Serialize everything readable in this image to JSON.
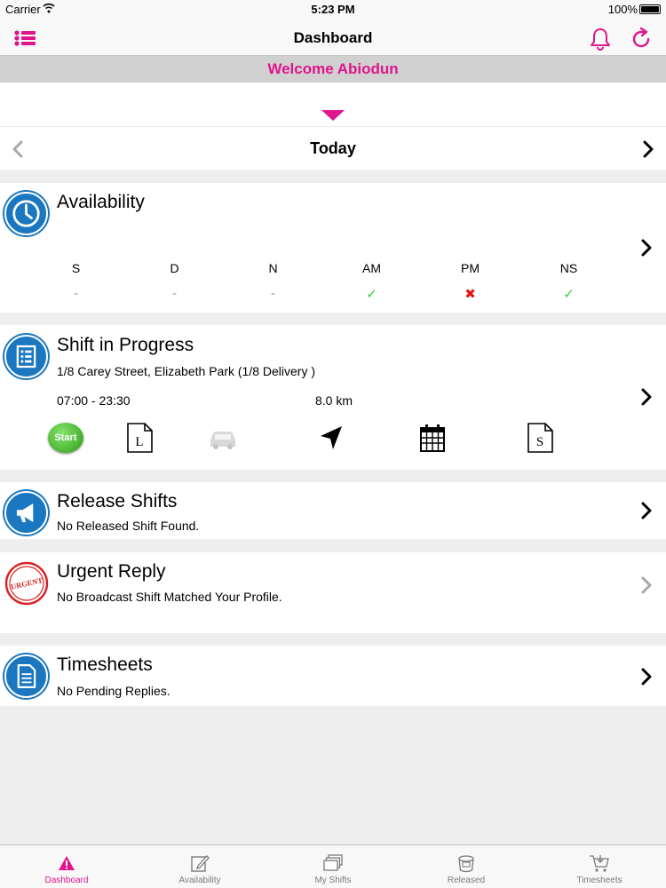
{
  "status": {
    "carrier": "Carrier",
    "time": "5:23 PM",
    "battery": "100%"
  },
  "nav": {
    "title": "Dashboard",
    "welcome": "Welcome Abiodun"
  },
  "date_nav": {
    "label": "Today"
  },
  "availability": {
    "title": "Availability",
    "columns": [
      {
        "label": "S",
        "value": "-"
      },
      {
        "label": "D",
        "value": "-"
      },
      {
        "label": "N",
        "value": "-"
      },
      {
        "label": "AM",
        "value": "✓"
      },
      {
        "label": "PM",
        "value": "✖"
      },
      {
        "label": "NS",
        "value": "✓"
      }
    ]
  },
  "shift": {
    "title": "Shift in Progress",
    "address": "1/8 Carey Street, Elizabeth Park (1/8 Delivery )",
    "time_range": "07:00 - 23:30",
    "distance": "8.0 km",
    "start_label": "Start",
    "doc_l_letter": "L",
    "doc_s_letter": "S"
  },
  "release": {
    "title": "Release Shifts",
    "subtitle": "No Released Shift Found."
  },
  "urgent": {
    "title": "Urgent Reply",
    "subtitle": "No Broadcast Shift Matched Your Profile.",
    "stamp_text": "URGENT"
  },
  "timesheets": {
    "title": "Timesheets",
    "subtitle": "No Pending Replies."
  },
  "tabs": [
    {
      "label": "Dashboard",
      "icon": "warning-icon"
    },
    {
      "label": "Availability",
      "icon": "edit-icon"
    },
    {
      "label": "My Shifts",
      "icon": "stack-icon"
    },
    {
      "label": "Released",
      "icon": "bucket-icon"
    },
    {
      "label": "Timesheets",
      "icon": "cart-icon"
    }
  ],
  "colors": {
    "accent": "#e0148c",
    "icon_blue": "#1a77c0",
    "tick": "#2fcf2f",
    "cross": "#e01515"
  }
}
